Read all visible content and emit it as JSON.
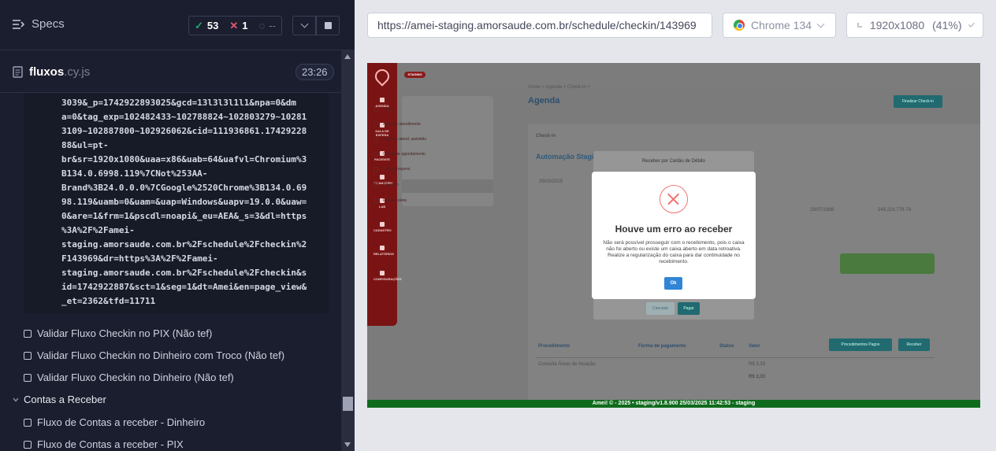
{
  "runner": {
    "specs_label": "Specs",
    "stats": {
      "passed": "53",
      "failed": "1",
      "pending": "--"
    },
    "file": {
      "name": "fluxos",
      "ext": ".cy.js",
      "duration": "23:26"
    },
    "log_lines": [
      "3039&_p=1742922893025&gcd=13l3l3l1l1&npa=0&dm",
      "a=0&tag_exp=102482433~102788824~102803279~10281",
      "3109~102887800~102926062&cid=111936861.17429228",
      "88&ul=pt-",
      "br&sr=1920x1080&uaa=x86&uab=64&uafvl=Chromium%3",
      "B134.0.6998.119%7CNot%253AA-",
      "Brand%3B24.0.0.0%7CGoogle%2520Chrome%3B134.0.69",
      "98.119&uamb=0&uam=&uap=Windows&uapv=19.0.0&uaw=",
      "0&are=1&frm=1&pscdl=noapi&_eu=AEA&_s=3&dl=https",
      "%3A%2F%2Famei-",
      "staging.amorsaude.com.br%2Fschedule%2Fcheckin%2",
      "F143969&dr=https%3A%2F%2Famei-",
      "staging.amorsaude.com.br%2Fschedule%2Fcheckin&s",
      "id=1742922887&sct=1&seg=1&dt=Amei&en=page_view&",
      "_et=2362&tfd=11711"
    ],
    "tests": [
      "Validar Fluxo Checkin no PIX (Não tef)",
      "Validar Fluxo Checkin no Dinheiro com Troco (Não tef)",
      "Validar Fluxo Checkin no Dinheiro (Não tef)"
    ],
    "suite": "Contas a Receber",
    "suite_tests": [
      "Fluxo de Contas a receber - Dinheiro",
      "Fluxo de Contas a receber - PIX"
    ]
  },
  "browser": {
    "url": "https://amei-staging.amorsaude.com.br/schedule/checkin/143969",
    "name": "Chrome 134",
    "viewport": "1920x1080",
    "zoom": "(41%)"
  },
  "app": {
    "breadcrumb": "Home > Agenda > Check-in >",
    "page_title": "Agenda",
    "finalize_btn": "Finalizar Check-in",
    "side_items": [
      "AGENDA",
      "SALA DE ESPERA",
      "PACIENTE",
      "FINANCEIRO",
      "LAB",
      "CADASTRO",
      "RELATÓRIOS",
      "CONFIGURAÇÕES"
    ],
    "menu_items": [
      "Menu",
      "Agendar atendimento",
      "Agendar atend. assistido",
      "Confirmar agendamento",
      "Lista de espera",
      "Check-in",
      "Fila de coleta"
    ],
    "checkin_label": "Check-in",
    "patient_label": "Automação Staging",
    "date_value": "25/03/2025",
    "birth_value": "29/07/1988",
    "cpf_value": "549.216.779-79",
    "sub_modal_title": "Receber por Cartão de Débito",
    "sub_cancel": "Cancelar",
    "sub_pay": "Pagar",
    "proc_header": [
      "Procedimento",
      "Forma de pagamento",
      "Status",
      "Valor"
    ],
    "proc_row": "Consulta Áreas de Atuação",
    "proc_value": "R$ 3,33",
    "btn_proc_pagos": "Procedimentos Pagos",
    "btn_receber": "Receber",
    "footer": "Amei! © - 2025 • staging/v1.8.900 25/03/2025 11:42:53 - staging"
  },
  "error_dialog": {
    "title": "Houve um erro ao receber",
    "message": "Não será possível prosseguir com o recebimento, pois o caixa não foi aberto ou existe um caixa aberto em data retroativa. Realize a regularização do caixa para dar continuidade no recebimento.",
    "ok": "Ok"
  },
  "colors": {
    "passed": "#1fa971",
    "failed": "#e45770",
    "ok_button": "#3085d6",
    "error_icon": "#f27474",
    "footer": "#0f6b1c"
  }
}
